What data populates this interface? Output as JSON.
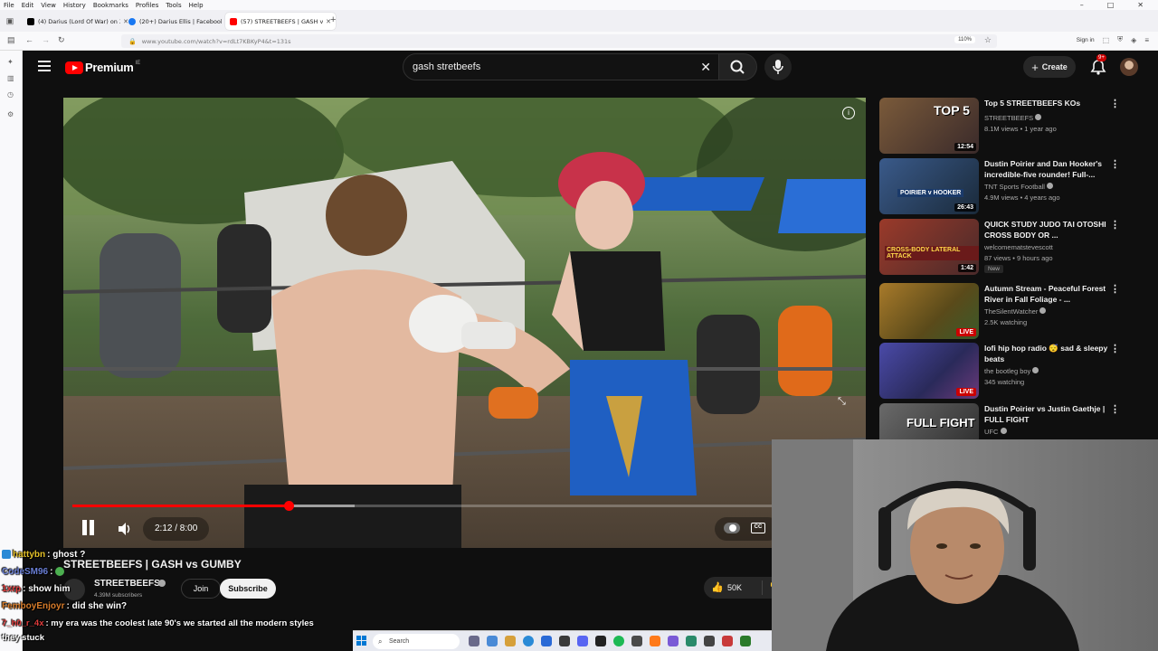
{
  "browser": {
    "menu": [
      "File",
      "Edit",
      "View",
      "History",
      "Bookmarks",
      "Profiles",
      "Tools",
      "Help"
    ],
    "tabs": [
      {
        "title": "(4) Darius (Lord Of War) on X: \"",
        "icon": "x-logo-icon",
        "color": "#000000"
      },
      {
        "title": "(20+) Darius Ellis | Facebook",
        "icon": "facebook-icon",
        "color": "#1877f2"
      },
      {
        "title": "(57) STREETBEEFS | GASH v",
        "icon": "youtube-icon",
        "color": "#ff0000"
      }
    ],
    "url": "www.youtube.com/watch?v=rdLt7KBKyP4&t=131s",
    "zoom": "110%",
    "sign_in": "Sign in"
  },
  "youtube": {
    "logo_text": "Premium",
    "region": "IE",
    "search_query": "gash stretbeefs",
    "create_label": "Create",
    "notif_count": "9+"
  },
  "video": {
    "title": "STREETBEEFS | GASH vs GUMBY",
    "time": "2:12 / 8:00",
    "progress_fraction": 0.275,
    "buffered_fraction": 0.36,
    "channel": "STREETBEEFS",
    "subscribers": "4.39M subscribers",
    "join_label": "Join",
    "subscribe_label": "Subscribe",
    "likes": "50K"
  },
  "recommendations": [
    {
      "title": "Top 5 STREETBEEFS KOs",
      "channel": "STREETBEEFS",
      "verified": true,
      "meta": "8.1M views • 1 year ago",
      "duration": "12:54",
      "thumb_color": "#6b4a3a"
    },
    {
      "title": "Dustin Poirier and Dan Hooker's incredible-five rounder! Full-...",
      "channel": "TNT Sports Football",
      "verified": true,
      "meta": "4.9M views • 4 years ago",
      "duration": "26:43",
      "thumb_color": "#2a3d5c"
    },
    {
      "title": "QUICK STUDY JUDO   TAI OTOSHI CROSS BODY OR ...",
      "channel": "welcomematstevescott",
      "verified": false,
      "meta": "87 views • 9 hours ago",
      "duration": "1:42",
      "badge": "New",
      "thumb_color": "#8a4a3a"
    },
    {
      "title": "Autumn Stream - Peaceful Forest River in Fall Foliage - ...",
      "channel": "TheSilentWatcher",
      "verified": true,
      "meta": "2.5K watching",
      "live": "LIVE",
      "thumb_color": "#8a6a2a"
    },
    {
      "title": "lofi hip hop radio 😴 sad & sleepy beats",
      "channel": "the bootleg boy",
      "verified": true,
      "meta": "345 watching",
      "live": "LIVE",
      "thumb_color": "#3a3a8a"
    },
    {
      "title": "Dustin Poirier vs Justin Gaethje | FULL FIGHT",
      "channel": "UFC",
      "verified": true,
      "meta": "",
      "thumb_color": "#5a5a5a",
      "thumb_text": "FULL FIGHT"
    }
  ],
  "chat": [
    {
      "user": "hattybn",
      "message": "ghost ?",
      "color": "#e6c229"
    },
    {
      "user": "CodeSM96",
      "message": "",
      "color": "#6a7fd6"
    },
    {
      "user": "1xrp",
      "message": "show him",
      "color": "#e03c3c"
    },
    {
      "user": "FemboyEnjoyr",
      "message": "did she win?",
      "color": "#d87c2a"
    },
    {
      "user": "7_h0_r_4x",
      "message": "my era was the coolest late 90's we started all the modern styles",
      "color": "#e03c3c"
    },
    {
      "user": "",
      "message": "they stuck",
      "color": "#ffffff"
    }
  ],
  "taskbar": {
    "search_label": "Search"
  }
}
